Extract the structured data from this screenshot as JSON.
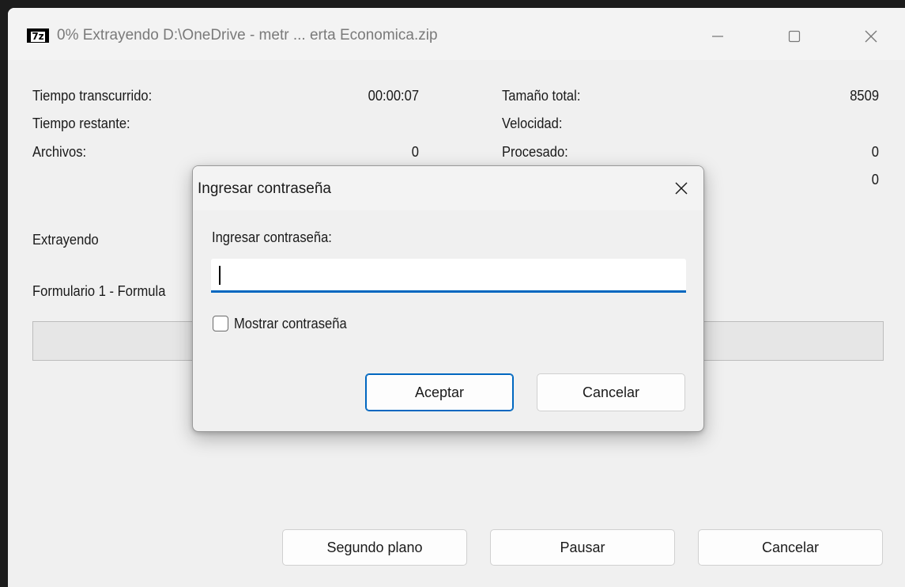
{
  "window": {
    "title": "0% Extrayendo D:\\OneDrive - metr ... erta Economica.zip",
    "icon_text": "7z"
  },
  "stats": {
    "elapsed_label": "Tiempo transcurrido:",
    "elapsed_value": "00:00:07",
    "remaining_label": "Tiempo restante:",
    "files_label": "Archivos:",
    "files_value": "0",
    "total_size_label": "Tamaño total:",
    "total_size_value": "8509",
    "speed_label": "Velocidad:",
    "processed_label": "Procesado:",
    "processed_value": "0",
    "packed_value": "0"
  },
  "status": {
    "operation": "Extrayendo",
    "current_file": "Formulario 1 - Formula"
  },
  "progress": {
    "fraction": 0.0
  },
  "buttons": {
    "background": "Segundo plano",
    "pause": "Pausar",
    "cancel": "Cancelar"
  },
  "dialog": {
    "title": "Ingresar contraseña",
    "prompt": "Ingresar contraseña:",
    "password_value": "",
    "show_password_label": "Mostrar contraseña",
    "show_password_checked": false,
    "ok_label": "Aceptar",
    "cancel_label": "Cancelar"
  },
  "colors": {
    "accent": "#0067c0",
    "window_bg": "#f0f0f0",
    "progress_fill": "#06b025"
  }
}
